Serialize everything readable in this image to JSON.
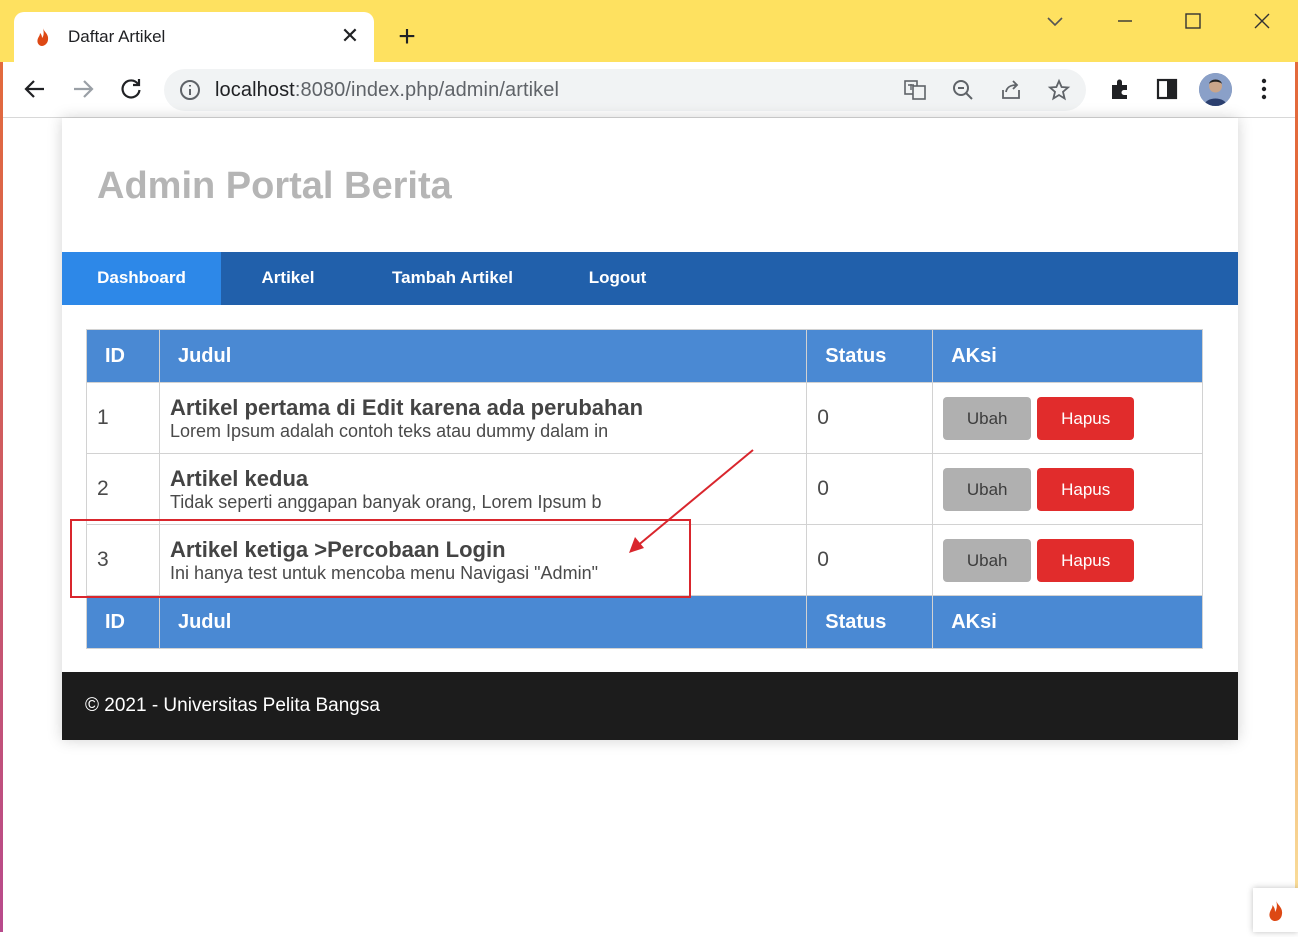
{
  "browser": {
    "tab_title": "Daftar Artikel",
    "url_host": "localhost",
    "url_rest": ":8080/index.php/admin/artikel"
  },
  "site": {
    "title": "Admin Portal Berita"
  },
  "nav": {
    "items": [
      {
        "label": "Dashboard",
        "active": true
      },
      {
        "label": "Artikel",
        "active": false
      },
      {
        "label": "Tambah Artikel",
        "active": false
      },
      {
        "label": "Logout",
        "active": false
      }
    ]
  },
  "table": {
    "headers": [
      "ID",
      "Judul",
      "Status",
      "AKsi"
    ],
    "rows": [
      {
        "id": "1",
        "title": "Artikel pertama di Edit karena ada perubahan",
        "excerpt": "Lorem Ipsum adalah contoh teks atau dummy dalam in",
        "status": "0",
        "edit": "Ubah",
        "delete": "Hapus"
      },
      {
        "id": "2",
        "title": "Artikel kedua",
        "excerpt": "Tidak seperti anggapan banyak orang, Lorem Ipsum b",
        "status": "0",
        "edit": "Ubah",
        "delete": "Hapus"
      },
      {
        "id": "3",
        "title": "Artikel ketiga >Percobaan Login",
        "excerpt": "Ini hanya test untuk mencoba menu Navigasi \"Admin\"",
        "status": "0",
        "edit": "Ubah",
        "delete": "Hapus"
      }
    ]
  },
  "footer": {
    "text": "© 2021 - Universitas Pelita Bangsa"
  },
  "colors": {
    "titlebar": "#fee160",
    "nav": "#2160ab",
    "nav_active": "#2d88e8",
    "table_header": "#4a89d3",
    "btn_ubah": "#b0b0b0",
    "btn_hapus": "#e12c2c",
    "footer": "#1c1c1c",
    "annotation": "#d9262d"
  }
}
